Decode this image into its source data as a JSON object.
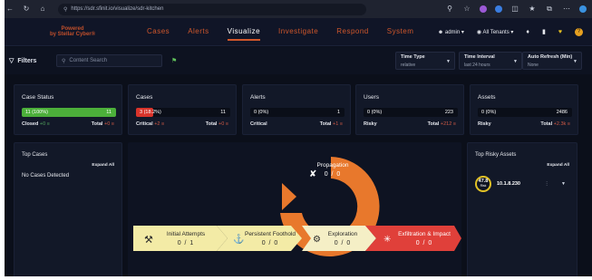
{
  "browser": {
    "url": "https://sdr.sfinit.io/visualize/sdr-kitchen"
  },
  "nav": {
    "brand_line1": "Powered",
    "brand_line2": "by Stellar Cyber®",
    "tabs": [
      "Cases",
      "Alerts",
      "Visualize",
      "Investigate",
      "Respond",
      "System"
    ],
    "active_tab": "Visualize",
    "user": "admin",
    "tenant": "All Tenants"
  },
  "filters": {
    "label": "Filters",
    "search_placeholder": "Content Search",
    "time_type_label": "Time Type",
    "time_type_value": "relative",
    "time_interval_label": "Time Interval",
    "time_interval_value": "last 24 hours",
    "auto_refresh_label": "Auto Refresh (Min)",
    "auto_refresh_value": "None"
  },
  "stats": {
    "case_status": {
      "title": "Case Status",
      "bar_left": "11 (100%)",
      "bar_right": "11",
      "bar_fill": 1.0,
      "sub_left_label": "Closed",
      "sub_left_delta": "+0 ≡",
      "sub_right_label": "Total",
      "sub_right_delta": "+0 ≡"
    },
    "cases": {
      "title": "Cases",
      "bar_left": "3 (18.2%)",
      "bar_right": "11",
      "bar_fill": 0.182,
      "sub_left_label": "Critical",
      "sub_left_delta": "+2 ≡",
      "sub_right_label": "Total",
      "sub_right_delta": "+0 ≡"
    },
    "alerts": {
      "title": "Alerts",
      "bar_left": "0 (0%)",
      "bar_right": "1",
      "bar_fill": 0,
      "sub_left_label": "Critical",
      "sub_left_delta": "",
      "sub_right_label": "Total",
      "sub_right_delta": "+1 ≡"
    },
    "users": {
      "title": "Users",
      "bar_left": "0 (0%)",
      "bar_right": "223",
      "bar_fill": 0,
      "sub_left_label": "Risky",
      "sub_left_delta": "",
      "sub_right_label": "Total",
      "sub_right_delta": "+212 ≡"
    },
    "assets": {
      "title": "Assets",
      "bar_left": "0 (0%)",
      "bar_right": "2486",
      "bar_fill": 0,
      "sub_left_label": "Risky",
      "sub_left_delta": "",
      "sub_right_label": "Total",
      "sub_right_delta": "+2.3k ≡"
    }
  },
  "top_cases": {
    "title": "Top Cases",
    "expand": "Expand All",
    "empty": "No Cases Detected"
  },
  "top_assets": {
    "title": "Top Risky Assets",
    "expand": "Expand All",
    "risk_score": "47.8",
    "risk_label": "Risk",
    "asset_ip": "10.1.8.230"
  },
  "kill_chain": {
    "initial": {
      "label": "Initial Attempts",
      "count": "0 / 1"
    },
    "persistent": {
      "label": "Persistent Foothold",
      "count": "0 / 0"
    },
    "exploration": {
      "label": "Exploration",
      "count": "0 / 0"
    },
    "propagation": {
      "label": "Propagation",
      "count": "0 / 0"
    },
    "exfiltration": {
      "label": "Exfiltration & Impact",
      "count": "0 / 0"
    }
  },
  "colors": {
    "accent": "#d0572b",
    "green": "#4caf3a",
    "red": "#d9342b",
    "yellow_chev": "#f3eba6",
    "orange": "#e8782c"
  }
}
